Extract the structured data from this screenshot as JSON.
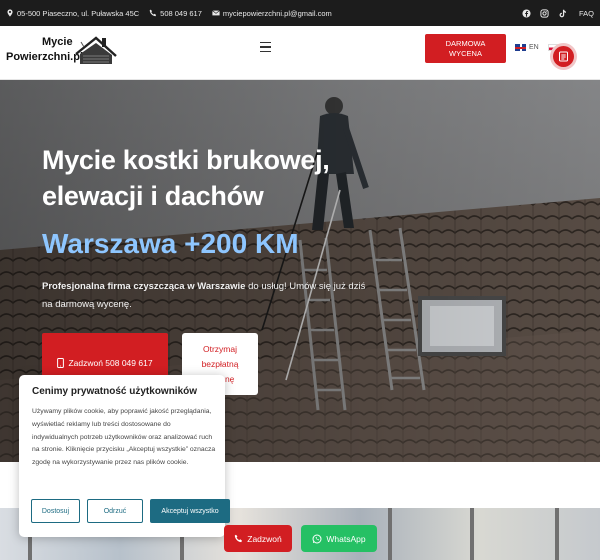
{
  "topbar": {
    "address": "05-500 Piaseczno, ul. Puławska 45C",
    "phone": "508 049 617",
    "email": "myciepowierzchni.pl@gmail.com",
    "faq": "FAQ"
  },
  "header": {
    "logo_line1": "Mycie",
    "logo_line2": "Powierzchni.pl",
    "cta_line1": "DARMOWA",
    "cta_line2": "WYCENA",
    "lang_en": "EN"
  },
  "hero": {
    "title_line1": "Mycie kostki brukowej,",
    "title_line2": "elewacji i dachów",
    "subtitle": "Warszawa +200 KM",
    "desc_bold": "Profesjonalna firma czyszcząca w Warszawie",
    "desc_rest": " do usług! Umów się już dziś na darmową wycenę.",
    "call_label": "Zadzwoń 508 049 617",
    "quote_line1": "Otrzymaj",
    "quote_line2": "bezpłatną",
    "quote_line3": "wycenę"
  },
  "cookie": {
    "title": "Cenimy prywatność użytkowników",
    "body": "Używamy plików cookie, aby poprawić jakość przeglądania, wyświetlać reklamy lub treści dostosowane do indywidualnych potrzeb użytkowników oraz analizować ruch na stronie. Kliknięcie przycisku „Akceptuj wszystkie” oznacza zgodę na wykorzystywanie przez nas plików cookie.",
    "customize": "Dostosuj",
    "reject": "Odrzuć",
    "accept": "Akceptuj wszystko"
  },
  "floating": {
    "call": "Zadzwoń",
    "whatsapp": "WhatsApp"
  },
  "colors": {
    "accent_red": "#d21e22",
    "cookie_teal": "#1d6b82",
    "whatsapp_green": "#25c064",
    "subtitle_blue": "#8ec6ff"
  }
}
